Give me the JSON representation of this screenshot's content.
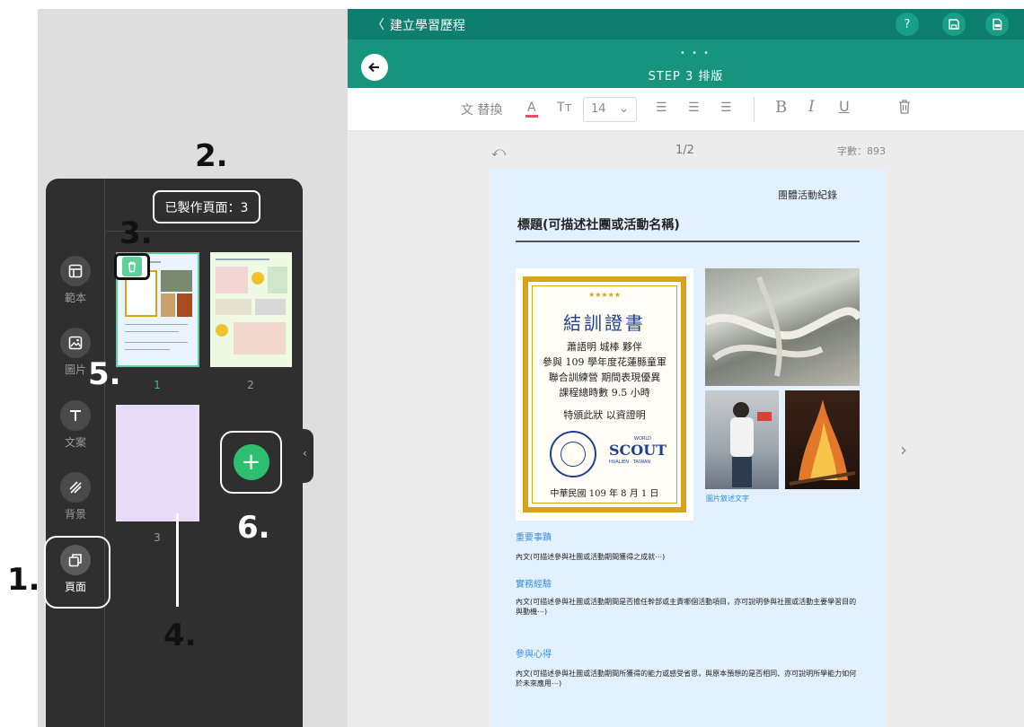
{
  "annotations": {
    "a1": "1.",
    "a2": "2.",
    "a3": "3.",
    "a4": "4.",
    "a5": "5.",
    "a6": "6."
  },
  "sidebar": {
    "items": [
      {
        "label": "範本",
        "icon": "template-icon"
      },
      {
        "label": "圖片",
        "icon": "image-icon"
      },
      {
        "label": "文案",
        "icon": "text-icon"
      },
      {
        "label": "背景",
        "icon": "background-icon"
      },
      {
        "label": "頁面",
        "icon": "pages-icon"
      }
    ]
  },
  "pages_panel": {
    "pages_made": "已製作頁面：3",
    "page_numbers": [
      "1",
      "2",
      "3"
    ],
    "add_label": "+"
  },
  "header": {
    "back_symbol": "〈",
    "title": "建立學習歷程",
    "help": "?",
    "step_dots": "• • •",
    "step": "STEP 3 排版"
  },
  "toolbar": {
    "replace": "替換",
    "font_size": "14",
    "bold": "B",
    "italic": "I",
    "underline": "U"
  },
  "editor": {
    "page_indicator": "1/2",
    "word_count": "字數：893"
  },
  "document": {
    "tag": "團體活動紀錄",
    "title": "標題(可描述社團或活動名稱)",
    "photo_caption": "圖片敘述文字",
    "sections": [
      {
        "heading": "重要事蹟",
        "body": "內文(可描述參與社團或活動期間獲得之成就⋯)"
      },
      {
        "heading": "實務經驗",
        "body": "內文(可描述參與社團或活動期間是否擔任幹部或主責哪個活動項目，亦可說明參與社團或活動主要學習目的與動機⋯)"
      },
      {
        "heading": "參與心得",
        "body": "內文(可描述參與社團或活動期間所獲得的能力或感受省思，與原本預想的是否相同、亦可說明所學能力如何於未來應用⋯)"
      }
    ]
  },
  "certificate": {
    "stars": "★★★★★",
    "heading": "結訓證書",
    "lines": [
      "蕭語明 城棒 夥伴",
      "參與 109 學年度花蓮縣童軍",
      "聯合訓練營 期間表現優異",
      "課程總時數 9.5 小時",
      "特頒此狀 以資證明"
    ],
    "world": "WORLD",
    "scout": "SCOUT",
    "scout_sub": "HUALIEN · TAIWAN",
    "date": "中華民國 109 年 8 月 1 日"
  },
  "colors": {
    "topbar": "#0e7f6e",
    "stepbar": "#16947d",
    "accent_green": "#2fbf71",
    "panel_dark": "#2f2f2f",
    "doc_bg": "#e3f0fd"
  }
}
